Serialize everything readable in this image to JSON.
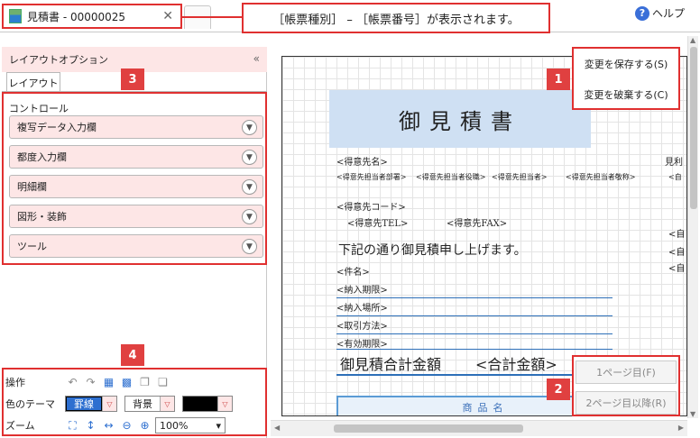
{
  "tabbar": {
    "doc_tab_title": "見積書 - 00000025",
    "close_glyph": "✕",
    "callout_text": "［帳票種別］ – ［帳票番号］が表示されます。",
    "help_label": "ヘルプ",
    "help_glyph": "?"
  },
  "left_panel": {
    "header": "レイアウトオプション",
    "collapse_glyph": "«",
    "tab_label": "レイアウト",
    "controls_title": "コントロール",
    "sections": [
      {
        "label": "複写データ入力欄"
      },
      {
        "label": "都度入力欄"
      },
      {
        "label": "明細欄"
      },
      {
        "label": "図形・装飾"
      },
      {
        "label": "ツール"
      }
    ],
    "chevron_glyph": "▼",
    "operations": {
      "ops_label": "操作",
      "theme_label": "色のテーマ",
      "theme_line": "罫線",
      "theme_bg": "背景",
      "zoom_label": "ズーム",
      "zoom_value": "100%",
      "drop_glyph": "▽"
    }
  },
  "markers": {
    "m1": "1",
    "m2": "2",
    "m3": "3",
    "m4": "4"
  },
  "actions": {
    "save": "変更を保存する(S)",
    "discard": "変更を破棄する(C)",
    "page1": "1ページ目(F)",
    "page2": "2ページ目以降(R)"
  },
  "document": {
    "title": "御見積書",
    "recipient_name": "<得意先名>",
    "recipient_dept": "<得意先担当者部署>",
    "recipient_role": "<得意先担当者役職>",
    "recipient_person": "<得意先担当者>",
    "recipient_honorific": "<得意先担当者敬称>",
    "recipient_code": "<得意先コード>",
    "recipient_tel": "<得意先TEL>",
    "recipient_fax": "<得意先FAX>",
    "intro": "下記の通り御見積申し上げます。",
    "subject": "<件名>",
    "delivery_deadline": "<納入期限>",
    "delivery_place": "<納入場所>",
    "payment_method": "<取引方法>",
    "validity": "<有効期限>",
    "total_label": "御見積合計金額",
    "total_value": "<合計金額>",
    "table_header": "商品名",
    "clip_a": "見利",
    "clip_b": "<自",
    "clip_c": "<自",
    "clip_d": "<自",
    "clip_e": "<自"
  },
  "colors": {
    "accent_red": "#e03030",
    "panel_pink": "#fde6e6",
    "title_blue": "#cfe0f3",
    "line_blue": "#2d6fb8",
    "theme_line_fill": "#2d6fd0",
    "theme_swatch_black": "#000000"
  }
}
